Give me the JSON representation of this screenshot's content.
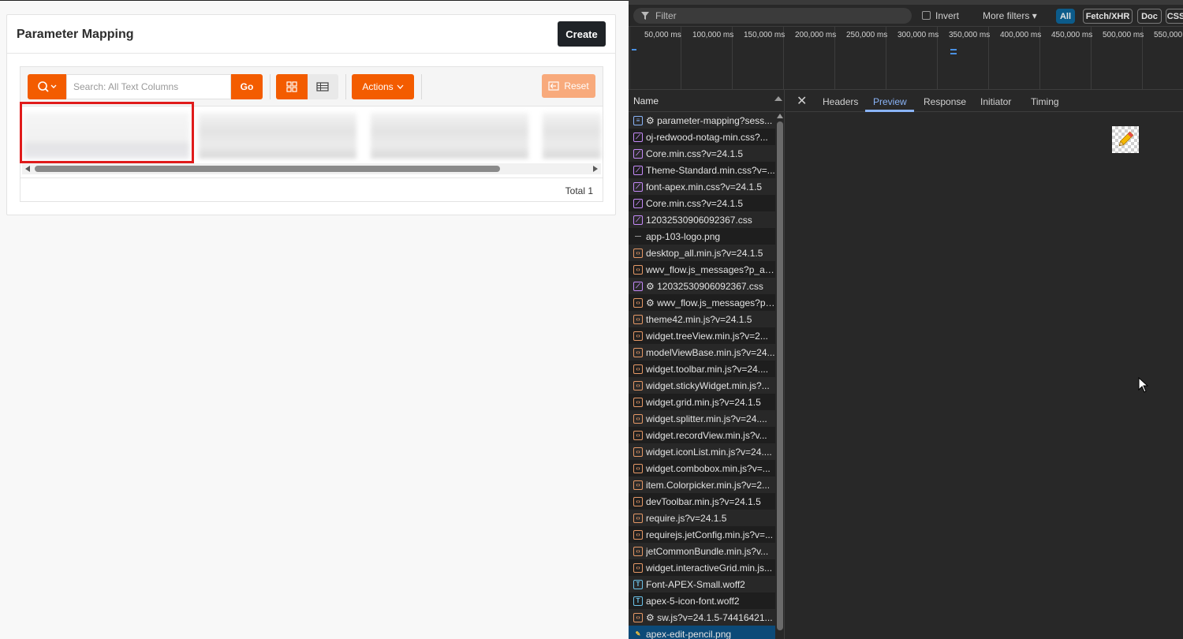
{
  "apex": {
    "region_title": "Parameter Mapping",
    "create_label": "Create",
    "search_placeholder": "Search: All Text Columns",
    "go_label": "Go",
    "actions_label": "Actions",
    "reset_label": "Reset",
    "footer_total": "Total 1",
    "accent_color": "#f35c00"
  },
  "devtools": {
    "filter_placeholder": "Filter",
    "invert_label": "Invert",
    "more_filters_label": "More filters",
    "chips": [
      "All",
      "Fetch/XHR",
      "Doc",
      "CSS"
    ],
    "timeline_ticks": [
      "50,000 ms",
      "100,000 ms",
      "150,000 ms",
      "200,000 ms",
      "250,000 ms",
      "300,000 ms",
      "350,000 ms",
      "400,000 ms",
      "450,000 ms",
      "500,000 ms",
      "550,000"
    ],
    "name_header": "Name",
    "requests": [
      {
        "type": "doc",
        "name": "⚙ parameter-mapping?sess..."
      },
      {
        "type": "css",
        "name": "oj-redwood-notag-min.css?..."
      },
      {
        "type": "css",
        "name": "Core.min.css?v=24.1.5"
      },
      {
        "type": "css",
        "name": "Theme-Standard.min.css?v=..."
      },
      {
        "type": "css",
        "name": "font-apex.min.css?v=24.1.5"
      },
      {
        "type": "css",
        "name": "Core.min.css?v=24.1.5"
      },
      {
        "type": "css",
        "name": "12032530906092367.css"
      },
      {
        "type": "img",
        "name": "app-103-logo.png"
      },
      {
        "type": "js",
        "name": "desktop_all.min.js?v=24.1.5"
      },
      {
        "type": "js",
        "name": "wwv_flow.js_messages?p_ap..."
      },
      {
        "type": "css",
        "name": "⚙ 12032530906092367.css"
      },
      {
        "type": "js",
        "name": "⚙ wwv_flow.js_messages?p_..."
      },
      {
        "type": "js",
        "name": "theme42.min.js?v=24.1.5"
      },
      {
        "type": "js",
        "name": "widget.treeView.min.js?v=2..."
      },
      {
        "type": "js",
        "name": "modelViewBase.min.js?v=24..."
      },
      {
        "type": "js",
        "name": "widget.toolbar.min.js?v=24...."
      },
      {
        "type": "js",
        "name": "widget.stickyWidget.min.js?..."
      },
      {
        "type": "js",
        "name": "widget.grid.min.js?v=24.1.5"
      },
      {
        "type": "js",
        "name": "widget.splitter.min.js?v=24...."
      },
      {
        "type": "js",
        "name": "widget.recordView.min.js?v..."
      },
      {
        "type": "js",
        "name": "widget.iconList.min.js?v=24...."
      },
      {
        "type": "js",
        "name": "widget.combobox.min.js?v=..."
      },
      {
        "type": "js",
        "name": "item.Colorpicker.min.js?v=2..."
      },
      {
        "type": "js",
        "name": "devToolbar.min.js?v=24.1.5"
      },
      {
        "type": "js",
        "name": "require.js?v=24.1.5"
      },
      {
        "type": "js",
        "name": "requirejs.jetConfig.min.js?v=..."
      },
      {
        "type": "js",
        "name": "jetCommonBundle.min.js?v..."
      },
      {
        "type": "js",
        "name": "widget.interactiveGrid.min.js..."
      },
      {
        "type": "font",
        "name": "Font-APEX-Small.woff2"
      },
      {
        "type": "font",
        "name": "apex-5-icon-font.woff2"
      },
      {
        "type": "js",
        "name": "⚙ sw.js?v=24.1.5-74416421..."
      },
      {
        "type": "pen",
        "name": "apex-edit-pencil.png"
      }
    ],
    "detail_tabs": [
      "Headers",
      "Preview",
      "Response",
      "Initiator",
      "Timing"
    ],
    "active_tab": "Preview"
  }
}
